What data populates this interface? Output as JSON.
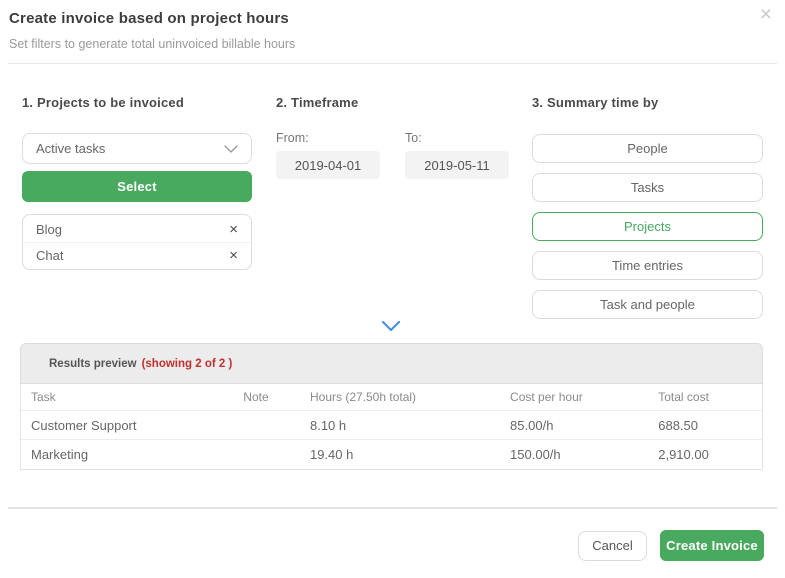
{
  "modal": {
    "title": "Create invoice based on project hours",
    "subtitle": "Set filters to generate total uninvoiced billable hours",
    "close_icon": "×"
  },
  "sections": {
    "projects": {
      "heading": "1. Projects to be invoiced",
      "filter_dropdown": {
        "value": "Active tasks"
      },
      "select_button": "Select",
      "remove_icon": "×",
      "selected_items": [
        {
          "label": "Blog"
        },
        {
          "label": "Chat"
        }
      ]
    },
    "timeframe": {
      "heading": "2. Timeframe",
      "from_label": "From:",
      "from_value": "2019-04-01",
      "to_label": "To:",
      "to_value": "2019-05-11"
    },
    "summary": {
      "heading": "3. Summary time by",
      "options": [
        {
          "label": "People",
          "selected": false
        },
        {
          "label": "Tasks",
          "selected": false
        },
        {
          "label": "Projects",
          "selected": true
        },
        {
          "label": "Time entries",
          "selected": false
        },
        {
          "label": "Task and people",
          "selected": false
        }
      ]
    }
  },
  "results": {
    "header_label": "Results preview",
    "header_badge": "(showing 2 of 2 )",
    "columns": [
      "Task",
      "Note",
      "Hours (27.50h total)",
      "Cost per hour",
      "Total cost"
    ],
    "rows": [
      {
        "task": "Customer Support",
        "note": "",
        "hours": "8.10 h",
        "cost_per_hour": "85.00/h",
        "total_cost": "688.50"
      },
      {
        "task": "Marketing",
        "note": "",
        "hours": "19.40 h",
        "cost_per_hour": "150.00/h",
        "total_cost": "2,910.00"
      }
    ]
  },
  "footer": {
    "cancel_label": "Cancel",
    "create_label": "Create Invoice"
  },
  "colors": {
    "accent_green": "#48a95f",
    "alert_red": "#c2302e",
    "chevron_blue": "#4a90e2"
  }
}
